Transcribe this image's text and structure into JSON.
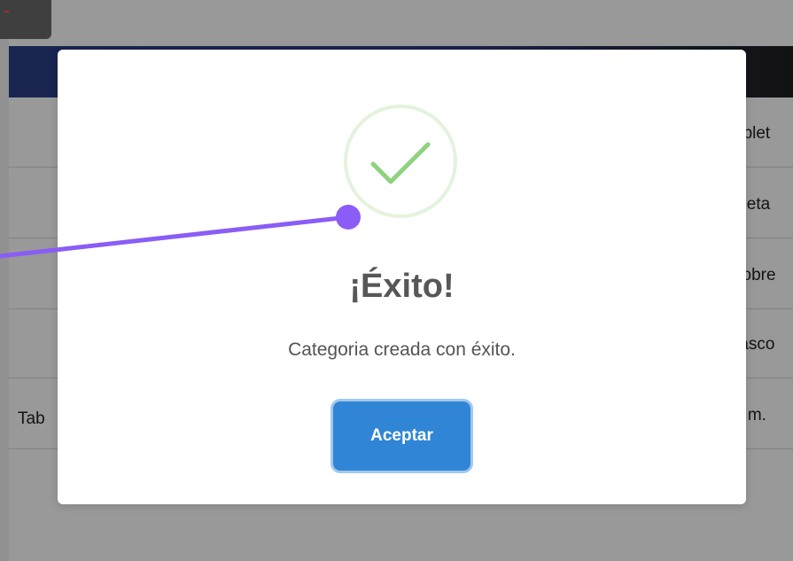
{
  "background": {
    "rows": [
      {
        "left": "",
        "right": "ablet"
      },
      {
        "left": "",
        "right": "bleta"
      },
      {
        "left": "",
        "right": "sobre"
      },
      {
        "left": "",
        "right": "rasco"
      },
      {
        "left": "Tab",
        "right": "a m."
      }
    ]
  },
  "modal": {
    "icon": "success-check-icon",
    "title": "¡Éxito!",
    "text": "Categoria creada con éxito.",
    "confirm_label": "Aceptar"
  },
  "colors": {
    "confirm_button": "#3085d6",
    "success_check": "#8fd27e",
    "success_ring": "#e3f3dd",
    "annotation": "#8b5cf6",
    "navbar": "#2b3f86"
  }
}
